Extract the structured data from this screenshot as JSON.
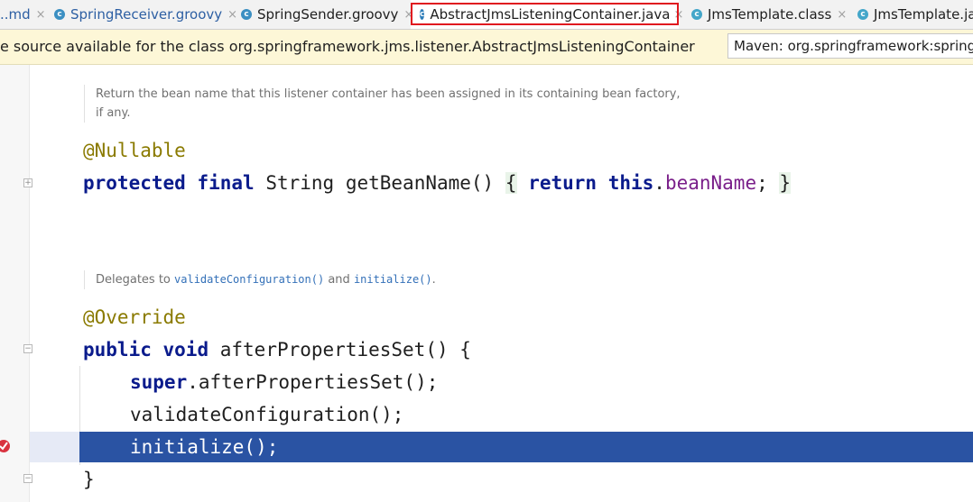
{
  "tabs": [
    {
      "label": "..md",
      "icon": "markdown-file-icon"
    },
    {
      "label": "SpringReceiver.groovy",
      "icon": "groovy-file-icon"
    },
    {
      "label": "SpringSender.groovy",
      "icon": "groovy-file-icon"
    },
    {
      "label": "AbstractJmsListeningContainer.java",
      "icon": "java-class-file-icon",
      "active": true
    },
    {
      "label": "JmsTemplate.class",
      "icon": "class-file-icon"
    },
    {
      "label": "JmsTemplate.java",
      "icon": "java-class-file-icon"
    }
  ],
  "close_glyph": "×",
  "notice": {
    "message": "e source available for the class org.springframework.jms.listener.AbstractJmsListeningContainer",
    "maven_dropdown": "Maven: org.springframework:spring-jms"
  },
  "editor": {
    "doc1_line1": "Return the bean name that this listener container has been assigned in its containing bean factory,",
    "doc1_line2": "if any.",
    "ann_nullable": "@Nullable",
    "line_getbean": {
      "kw1": "protected",
      "kw2": "final",
      "type": "String",
      "method": "getBeanName()",
      "open_brace": "{",
      "kw3": "return",
      "kw4": "this",
      "dot": ".",
      "field": "beanName",
      "semi": ";",
      "close_brace": "}"
    },
    "doc2_prefix": "Delegates to ",
    "doc2_code1": "validateConfiguration()",
    "doc2_mid": " and ",
    "doc2_code2": "initialize()",
    "doc2_suffix": ".",
    "ann_override": "@Override",
    "line_after": {
      "kw1": "public",
      "kw2": "void",
      "rest": "afterPropertiesSet() {"
    },
    "line_super": {
      "kw": "super",
      "rest": ".afterPropertiesSet();"
    },
    "line_validate": "validateConfiguration();",
    "line_initialize": "initialize();",
    "line_close": "}"
  },
  "colors": {
    "highlight_border": "#e0181f",
    "selected_line": "#2a53a3",
    "notice_bg": "#fdf7d7"
  }
}
